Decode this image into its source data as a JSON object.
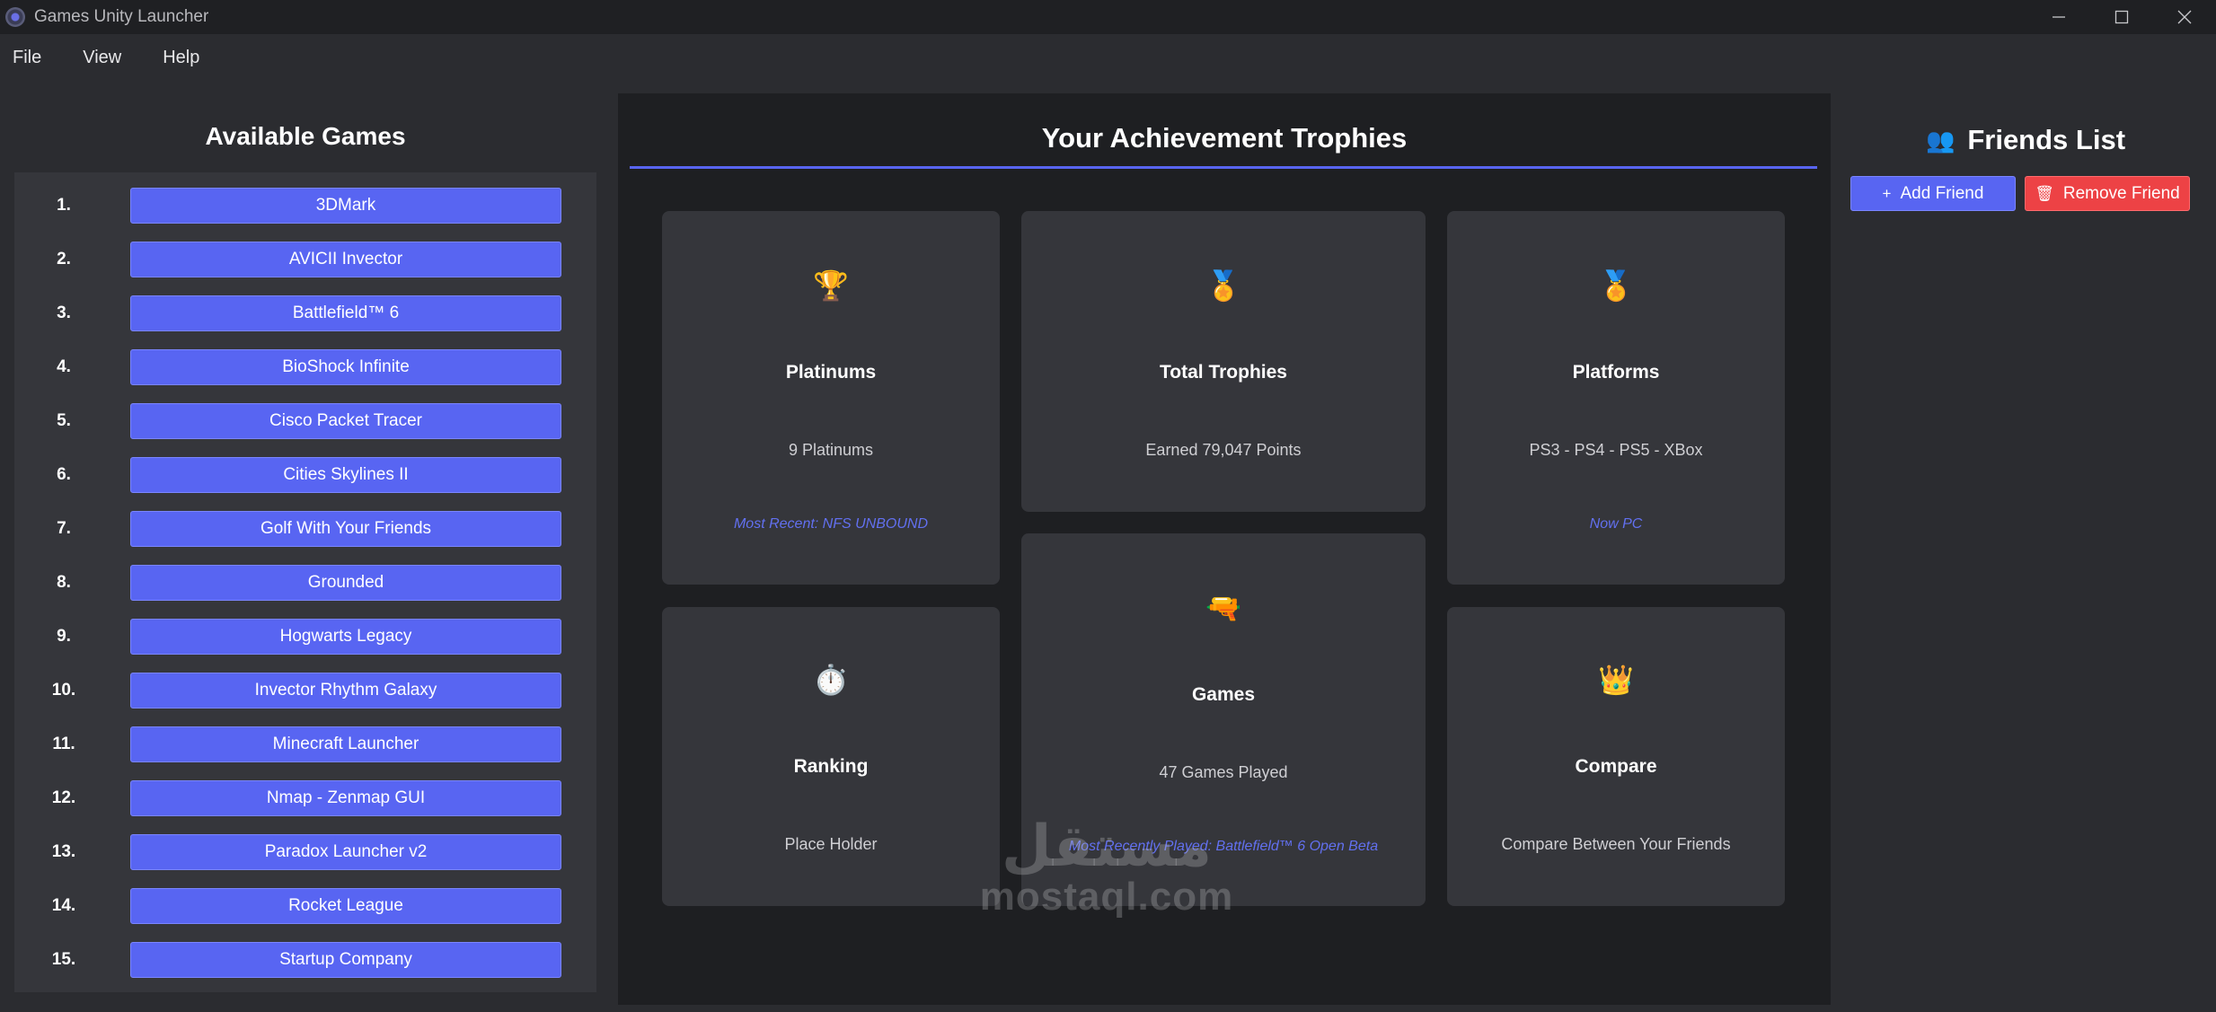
{
  "window": {
    "title": "Games Unity Launcher"
  },
  "menu": {
    "file": "File",
    "view": "View",
    "help": "Help"
  },
  "left": {
    "title": "Available Games",
    "games": [
      {
        "num": "1.",
        "name": "3DMark"
      },
      {
        "num": "2.",
        "name": "AVICII Invector"
      },
      {
        "num": "3.",
        "name": "Battlefield™ 6"
      },
      {
        "num": "4.",
        "name": "BioShock Infinite"
      },
      {
        "num": "5.",
        "name": "Cisco Packet Tracer"
      },
      {
        "num": "6.",
        "name": "Cities Skylines II"
      },
      {
        "num": "7.",
        "name": "Golf With Your Friends"
      },
      {
        "num": "8.",
        "name": "Grounded"
      },
      {
        "num": "9.",
        "name": "Hogwarts Legacy"
      },
      {
        "num": "10.",
        "name": "Invector Rhythm Galaxy"
      },
      {
        "num": "11.",
        "name": "Minecraft Launcher"
      },
      {
        "num": "12.",
        "name": "Nmap - Zenmap GUI"
      },
      {
        "num": "13.",
        "name": "Paradox Launcher v2"
      },
      {
        "num": "14.",
        "name": "Rocket League"
      },
      {
        "num": "15.",
        "name": "Startup Company"
      }
    ]
  },
  "center": {
    "title": "Your Achievement Trophies",
    "cards": {
      "platinums": {
        "icon": "🏆",
        "title": "Platinums",
        "value": "9 Platinums",
        "note": "Most Recent: NFS UNBOUND"
      },
      "total": {
        "icon": "🏅",
        "title": "Total Trophies",
        "value": "Earned 79,047 Points"
      },
      "platforms": {
        "icon": "🏅",
        "title": "Platforms",
        "value": "PS3 - PS4 - PS5 - XBox",
        "note": "Now PC"
      },
      "ranking": {
        "icon": "⏱️",
        "title": "Ranking",
        "value": "Place Holder"
      },
      "games": {
        "icon": "🔫",
        "title": "Games",
        "value": "47 Games Played",
        "note": "Most Recently Played: Battlefield™ 6 Open Beta"
      },
      "compare": {
        "icon": "👑",
        "title": "Compare",
        "value": "Compare Between Your Friends"
      }
    }
  },
  "right": {
    "icon": "👥",
    "title": "Friends List",
    "add_icon": "+",
    "add_label": "Add Friend",
    "remove_icon": "🗑",
    "remove_label": "Remove Friend"
  },
  "watermark": {
    "arabic": "مستقل",
    "latin": "mostaql.com"
  },
  "colors": {
    "accent": "#5865f2",
    "danger": "#ed4245",
    "panel": "#35363b",
    "background": "#2b2c30"
  }
}
